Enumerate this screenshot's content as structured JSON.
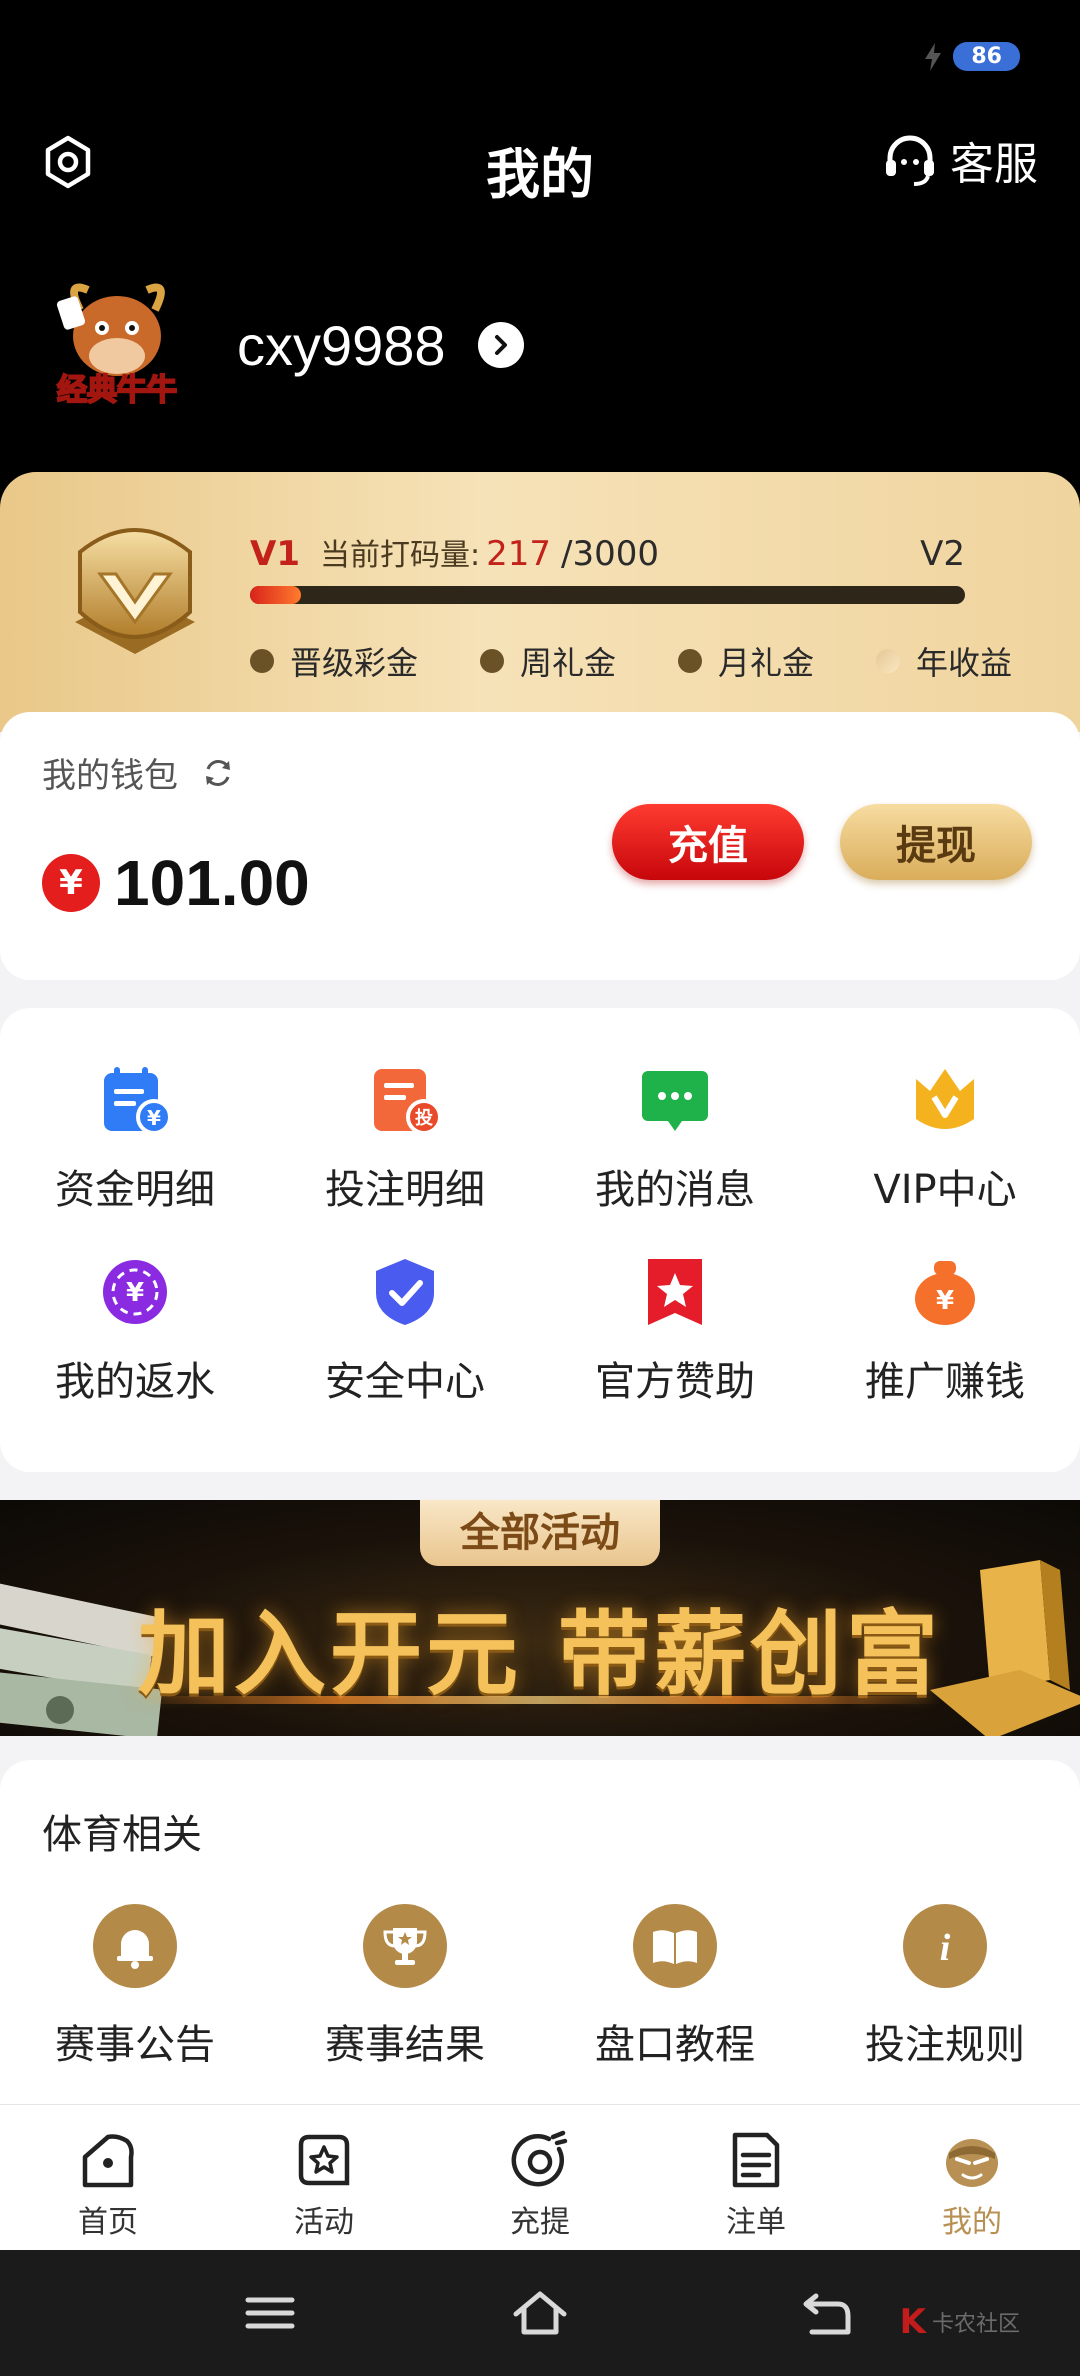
{
  "status_bar": {
    "battery": "86"
  },
  "header": {
    "title": "我的",
    "customer_service": "客服"
  },
  "profile": {
    "username": "cxy9988",
    "avatar_text": "经典牛牛"
  },
  "vip": {
    "current_level": "V1",
    "code_label": "当前打码量:",
    "code_current": "217",
    "code_total": "/3000",
    "next_level": "V2",
    "progress": 0.072,
    "perks": [
      "晋级彩金",
      "周礼金",
      "月礼金",
      "年收益"
    ]
  },
  "wallet": {
    "title": "我的钱包",
    "currency_symbol": "¥",
    "balance": "101.00",
    "recharge_label": "充值",
    "withdraw_label": "提现"
  },
  "menu": {
    "items": [
      {
        "label": "资金明细",
        "icon": "fund-detail-icon",
        "color": "#2f7cf6"
      },
      {
        "label": "投注明细",
        "icon": "bet-detail-icon",
        "color": "#f2683a"
      },
      {
        "label": "我的消息",
        "icon": "message-icon",
        "color": "#1fb24a"
      },
      {
        "label": "VIP中心",
        "icon": "vip-crown-icon",
        "color": "#f5b21f"
      },
      {
        "label": "我的返水",
        "icon": "rebate-chip-icon",
        "color": "#8a2be2"
      },
      {
        "label": "安全中心",
        "icon": "shield-check-icon",
        "color": "#4a5cf0"
      },
      {
        "label": "官方赞助",
        "icon": "star-flag-icon",
        "color": "#e51d2a"
      },
      {
        "label": "推广赚钱",
        "icon": "money-bag-icon",
        "color": "#f5702a"
      }
    ]
  },
  "banner": {
    "tag": "全部活动",
    "slogan": "加入开元 带薪创富"
  },
  "sports": {
    "title": "体育相关",
    "items": [
      {
        "label": "赛事公告",
        "icon": "bell-icon"
      },
      {
        "label": "赛事结果",
        "icon": "trophy-icon"
      },
      {
        "label": "盘口教程",
        "icon": "book-icon"
      },
      {
        "label": "投注规则",
        "icon": "info-icon"
      }
    ]
  },
  "tabbar": {
    "items": [
      {
        "label": "首页",
        "icon": "home-icon"
      },
      {
        "label": "活动",
        "icon": "activity-star-icon"
      },
      {
        "label": "充提",
        "icon": "recharge-withdraw-icon"
      },
      {
        "label": "注单",
        "icon": "bet-slip-icon"
      },
      {
        "label": "我的",
        "icon": "mine-mascot-icon"
      }
    ],
    "active_color": "#b89053"
  },
  "watermark": {
    "text": "卡农社区"
  }
}
